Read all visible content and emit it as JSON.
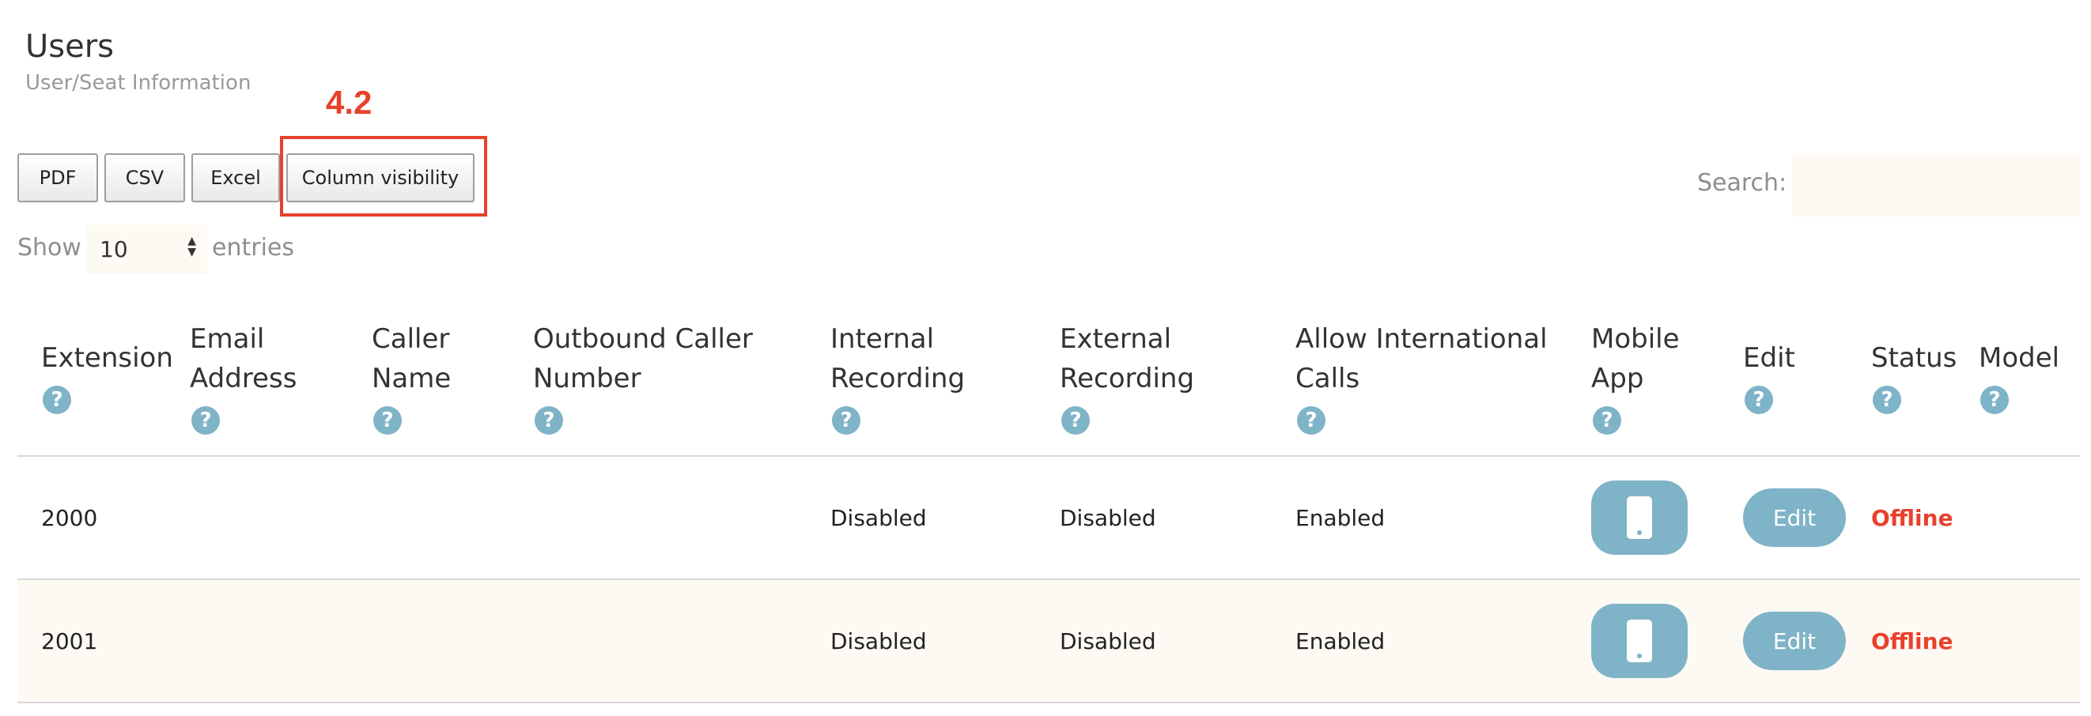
{
  "page": {
    "title": "Users",
    "subtitle": "User/Seat Information"
  },
  "annotation": {
    "label": "4.2",
    "color": "#e8412c"
  },
  "toolbar": {
    "pdf_label": "PDF",
    "csv_label": "CSV",
    "excel_label": "Excel",
    "column_visibility_label": "Column visibility"
  },
  "search": {
    "label": "Search:",
    "value": ""
  },
  "length": {
    "show_label": "Show",
    "selected": "10",
    "entries_label": "entries"
  },
  "table": {
    "help_icon": "?",
    "columns": [
      {
        "line1": "Extension",
        "line2": ""
      },
      {
        "line1": "Email",
        "line2": "Address"
      },
      {
        "line1": "Caller",
        "line2": "Name"
      },
      {
        "line1": "Outbound Caller",
        "line2": "Number"
      },
      {
        "line1": "Internal",
        "line2": "Recording"
      },
      {
        "line1": "External",
        "line2": "Recording"
      },
      {
        "line1": "Allow International",
        "line2": "Calls"
      },
      {
        "line1": "Mobile",
        "line2": "App"
      },
      {
        "line1": "Edit",
        "line2": ""
      },
      {
        "line1": "Status",
        "line2": ""
      },
      {
        "line1": "Model",
        "line2": ""
      }
    ],
    "rows": [
      {
        "extension": "2000",
        "email": "",
        "caller_name": "",
        "outbound_number": "",
        "internal_recording": "Disabled",
        "external_recording": "Disabled",
        "international_calls": "Enabled",
        "edit_label": "Edit",
        "status": "Offline",
        "model": ""
      },
      {
        "extension": "2001",
        "email": "",
        "caller_name": "",
        "outbound_number": "",
        "internal_recording": "Disabled",
        "external_recording": "Disabled",
        "international_calls": "Enabled",
        "edit_label": "Edit",
        "status": "Offline",
        "model": ""
      }
    ]
  },
  "colors": {
    "accent": "#7fb3c7",
    "offline": "#e8412c",
    "row_alt": "#fdf9f3"
  },
  "icons": {
    "help": "question-circle-icon",
    "mobile": "mobile-phone-icon",
    "sort": "select-arrows-icon"
  }
}
